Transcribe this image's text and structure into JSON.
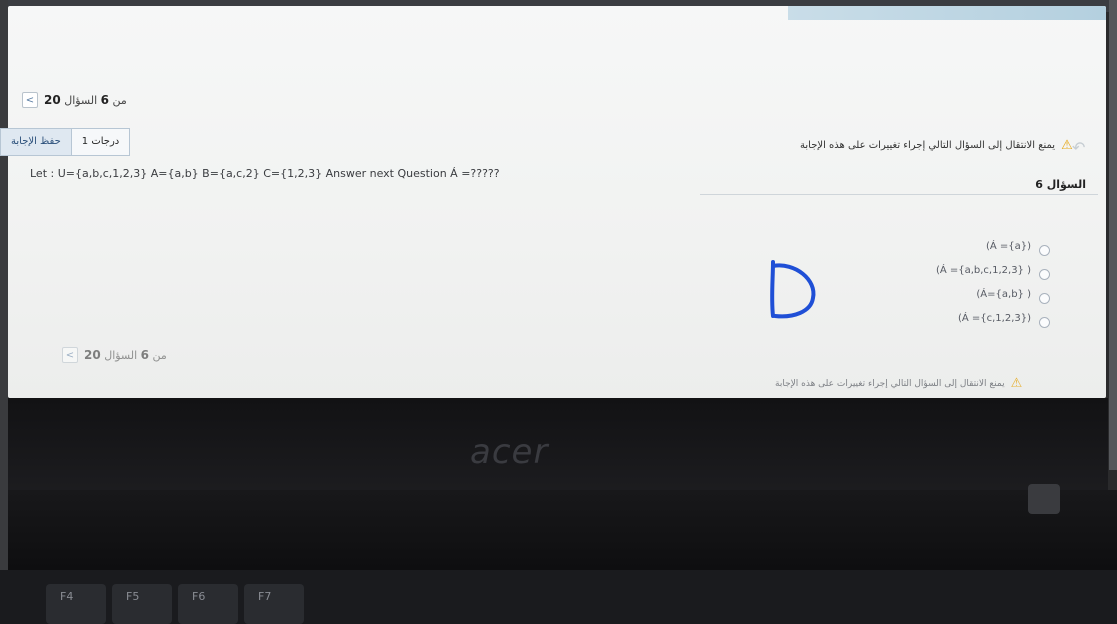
{
  "hardware": {
    "brand": "acer",
    "fkeys": [
      "F4",
      "F5",
      "F6",
      "F7"
    ]
  },
  "navigation": {
    "label": "السؤال",
    "current": "6",
    "of": "من",
    "total": "20",
    "arrow": "<"
  },
  "buttons": {
    "save_answer": "حفظ الإجابة",
    "grade": "1 درجات"
  },
  "warning": {
    "text": "يمنع الانتقال إلى السؤال التالي إجراء تغييرات على هذه الإجابة"
  },
  "question": {
    "title": "السؤال 6",
    "text": "Let : U={a,b,c,1,2,3} A={a,b} B={a,c,2} C={1,2,3} Answer next Question Á =?????"
  },
  "options": [
    {
      "label": "(Á ={a})"
    },
    {
      "label": "(Á ={a,b,c,1,2,3} )"
    },
    {
      "label": "(Á={a,b} )"
    },
    {
      "label": "(Á ={c,1,2,3})"
    }
  ],
  "colors": {
    "screen_bg": "#f4f5f5",
    "warning": "#e6a817",
    "ink": "#1f4fd6"
  }
}
